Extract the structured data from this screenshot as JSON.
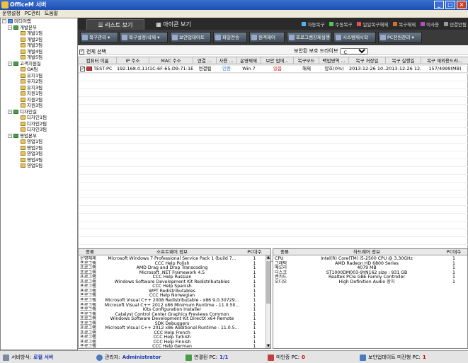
{
  "window": {
    "title": "OfficeM 서버"
  },
  "menu": [
    "운영설정",
    "PC관리",
    "도움말"
  ],
  "tree": {
    "root": "미디어랩",
    "groups": [
      {
        "name": "개발본부",
        "children": [
          "개발1팀",
          "개발2팀",
          "개발3팀",
          "개발4팀",
          "개발5팀"
        ]
      },
      {
        "name": "고객지원실",
        "children": [
          "OA팀",
          "유지1팀",
          "유지2팀",
          "유지3팀",
          "지원1팀",
          "지원2팀",
          "지원3팀"
        ]
      },
      {
        "name": "디자인실",
        "children": [
          "디자인1팀",
          "디자인2팀",
          "디자인3팀"
        ]
      },
      {
        "name": "영업본부",
        "children": [
          "영업1팀",
          "영업2팀",
          "영업3팀",
          "영업4팀",
          "영업5팀"
        ]
      }
    ]
  },
  "tabs": {
    "list": "리스트 보기",
    "icon": "아이콘 보기"
  },
  "legend": [
    {
      "label": "자동복구",
      "color": "#5ab0e8"
    },
    {
      "label": "수동복구",
      "color": "#5ac05a"
    },
    {
      "label": "일일복구해제",
      "color": "#e85050"
    },
    {
      "label": "복구해제",
      "color": "#d07030"
    },
    {
      "label": "이사용",
      "color": "#b050c0"
    },
    {
      "label": "연결안됨",
      "color": "#999999"
    }
  ],
  "toolbar": [
    "복구관리",
    "복구설정/삭제",
    "보안업데이트",
    "파일전송",
    "원격제어",
    "프로그램강제실행",
    "시스템재시작",
    "PC전원관리"
  ],
  "select_all": "전체 선택",
  "drive": {
    "label": "보안된 보호 드라이브",
    "value": "C"
  },
  "grid": {
    "columns": [
      "컴퓨터 이름",
      "IP 주소",
      "MAC 주소",
      "연결 ...",
      "사용 ...",
      "운영체제",
      "보안 업데...",
      "복구모드",
      "백업영역 ...",
      "복구 저장일",
      "복구 실행일",
      "복구 재외용드라..."
    ],
    "rows": [
      [
        "TEST-PC",
        "192.168.0.110",
        "1C-6F-65-D9-71-1E",
        "연결됨",
        "인증",
        "Win 7",
        "있음",
        "해제",
        "양호(0%)",
        "2013-12-26 10...",
        "2013-12-26 12...",
        "157/4999(MB)"
      ]
    ]
  },
  "software": {
    "columns": [
      "종류",
      "소프트웨어 정보",
      "PC대수"
    ],
    "rows": [
      [
        "운영체제",
        "Microsoft Windows 7 Professional Service Pack 1 (build 7...",
        "1"
      ],
      [
        "프로그램",
        "CCC Help Polish",
        "1"
      ],
      [
        "프로그램",
        "AMD Drag and Drop Transcoding",
        "1"
      ],
      [
        "프로그램",
        "Microsoft .NET Framework 4.5",
        "1"
      ],
      [
        "프로그램",
        "CCC Help Russian",
        "1"
      ],
      [
        "프로그램",
        "Windows Software Development Kit Redistributables",
        "1"
      ],
      [
        "프로그램",
        "CCC Help Spanish",
        "1"
      ],
      [
        "프로그램",
        "WPT Redistributables",
        "1"
      ],
      [
        "프로그램",
        "CCC Help Norwegian",
        "1"
      ],
      [
        "프로그램",
        "Microsoft Visual C++ 2008 Redistributable - x86 9.0.30729...",
        "1"
      ],
      [
        "프로그램",
        "Microsoft Visual C++ 2012 x86 Minimum Runtime - 11.0.50...",
        "1"
      ],
      [
        "프로그램",
        "Kits Configuration Installer",
        "1"
      ],
      [
        "프로그램",
        "Catalyst Control Center Graphics Previews Common",
        "1"
      ],
      [
        "프로그램",
        "Windows Software Development Kit DirectX x64 Remote",
        "1"
      ],
      [
        "프로그램",
        "SDK Debuggers",
        "1"
      ],
      [
        "프로그램",
        "Microsoft Visual C++ 2012 x86 Additional Runtime - 11.0.5...",
        "1"
      ],
      [
        "프로그램",
        "CCC Help French",
        "1"
      ],
      [
        "프로그램",
        "CCC Help Turkish",
        "1"
      ],
      [
        "프로그램",
        "CCC Help Finnish",
        "1"
      ],
      [
        "프로그램",
        "CCC Help German",
        "1"
      ]
    ]
  },
  "hardware": {
    "columns": [
      "종류",
      "하드웨어 정보",
      "PC대수"
    ],
    "rows": [
      [
        "CPU",
        "Intel(R) Core(TM) i5-2500 CPU @ 3.30GHz",
        "1"
      ],
      [
        "그래픽",
        "AMD Radeon HD 6800 Series",
        "1"
      ],
      [
        "메모리",
        "4079 MB",
        "1"
      ],
      [
        "디스크",
        "ST1000DM003-9YN162 size : 931 GB",
        "1"
      ],
      [
        "랜카드",
        "Realtek PCIe GBE Family Controller",
        "1"
      ],
      [
        "오디오",
        "High Definition Audio 장치",
        "1"
      ]
    ]
  },
  "status": {
    "server_label": "서비방식:",
    "server_value": "로컬 서버",
    "admin_label": "관리자:",
    "admin_value": "Administrator",
    "connected_label": "연결된 PC:",
    "connected_value": "1/1",
    "unauth_label": "미인증 PC:",
    "unauth_value": "0",
    "update_label": "보안업데이트 미진행 PC:",
    "update_value": "1"
  }
}
